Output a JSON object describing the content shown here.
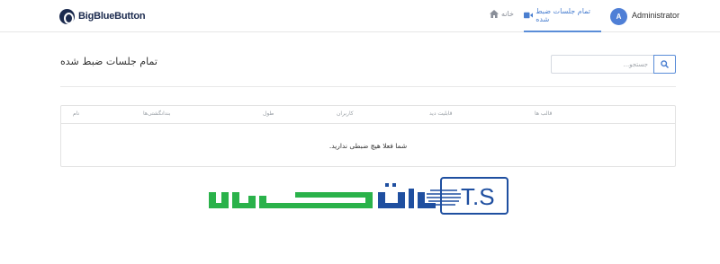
{
  "header": {
    "brand": "BigBlueButton",
    "nav": {
      "home_label": "خانه",
      "recordings_label": "تمام جلسات ضبط شده"
    },
    "user": {
      "avatar_initial": "A",
      "name": "Administrator"
    }
  },
  "page": {
    "title": "تمام جلسات ضبط شده",
    "search": {
      "placeholder": "جستجو..."
    }
  },
  "table": {
    "columns": [
      "قالب ها",
      "قابلیت دید",
      "کاربران",
      "طول",
      "بندانگشتی‌ها",
      "نام"
    ],
    "empty_message": "شما فعلا هیچ ضبطی ندارید."
  },
  "colors": {
    "accent": "#5a8dd8",
    "brand": "#1b2a4e",
    "watermark_green": "#2ab24a",
    "watermark_blue": "#1f4fa0"
  },
  "icons": {
    "home": "home-icon",
    "recordings": "video-icon",
    "search": "search-icon",
    "logo": "bigbluebutton-logo-icon"
  }
}
